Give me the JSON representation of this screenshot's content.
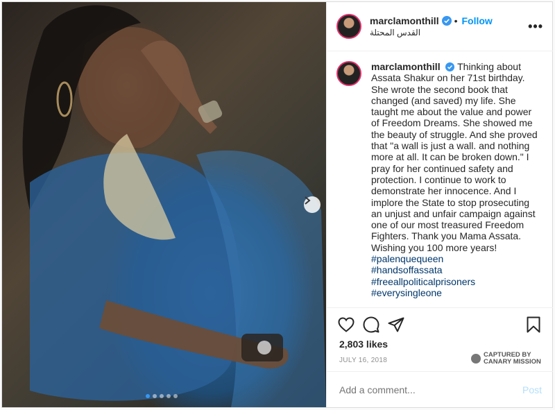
{
  "header": {
    "username": "marclamonthill",
    "follow_label": "Follow",
    "location": "القدس المحتلة",
    "more_icon": "more-options-icon"
  },
  "caption": {
    "username": "marclamonthill",
    "text": "Thinking about Assata Shakur on her 71st birthday. She wrote the second book that changed (and saved) my life. She taught me about the value and power of Freedom Dreams. She showed me the beauty of struggle. And she proved that \"a wall is just a wall. and nothing more at all. It can be broken down.\" I pray for her continued safety and protection. I continue to work to demonstrate her innocence. And I implore the State to stop prosecuting an unjust and unfair campaign against one of our most treasured Freedom Fighters. Thank you Mama Assata. Wishing you 100 more years!",
    "hashtags": [
      "#palenquequeen",
      "#handsoffassata",
      "#freeallpoliticalprisoners",
      "#everysingleone"
    ]
  },
  "actions": {
    "icons": [
      "heart-icon",
      "comment-icon",
      "share-icon",
      "bookmark-icon"
    ]
  },
  "likes": "2,803 likes",
  "date": "JULY 16, 2018",
  "watermark": {
    "line1": "CAPTURED BY",
    "line2": "CANARY MISSION"
  },
  "comment": {
    "placeholder": "Add a comment...",
    "post_label": "Post"
  },
  "carousel": {
    "total": 5,
    "active_index": 0
  },
  "colors": {
    "accent": "#0095f6",
    "hashtag": "#00376b",
    "post_disabled": "#b2dffc"
  }
}
